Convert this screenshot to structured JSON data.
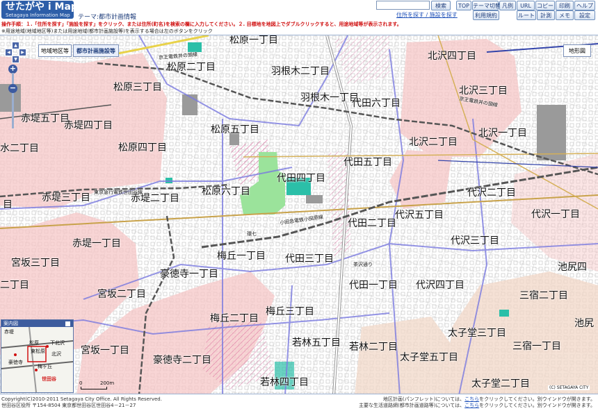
{
  "header": {
    "logo_title": "せたがや i Map",
    "logo_subtitle": "Setagaya Information Map",
    "theme_label": "テーマ:都市計画情報",
    "search_placeholder": "",
    "search_button": "検索",
    "buttons_row1": [
      "TOP",
      "テーマ切替",
      "凡例",
      "URL",
      "コピー",
      "印刷",
      "ヘルプ"
    ],
    "buttons_row2": [
      "利用規約",
      "ルート",
      "計測",
      "メモ",
      "設定"
    ],
    "address_search_link": "住所を探す",
    "link_separator": " / ",
    "facility_search_link": "施設を探す"
  },
  "instruction": "操作手順：１.「住所を探す」「施設を探す」をクリック、または住所(町名)を検索の欄に入力してください。２. 目標地を地図上でダブルクリックすると、用途地域等が表示されます。",
  "note": "※用途地域(地域地区等)または用途地域(都市計画施設等)を表示する場合は左のボタンをクリック",
  "map_tools": {
    "zoning_button": "地域地区等",
    "facility_button": "都市計画施設等",
    "map_type_button": "地形図",
    "zoom_in": "+",
    "zoom_out": "−"
  },
  "map_labels": [
    "松原一丁目",
    "松原二丁目",
    "羽根木二丁目",
    "北沢四丁目",
    "松原三丁目",
    "北沢三丁目",
    "羽根木一丁目",
    "代田六丁目",
    "赤堤五丁目",
    "赤堤四丁目",
    "松原五丁目",
    "北沢一丁目",
    "北沢二丁目",
    "水二丁目",
    "松原四丁目",
    "代田五丁目",
    "代田四丁目",
    "松原六丁目",
    "代沢二丁目",
    "目",
    "赤堤三丁目",
    "赤堤二丁目",
    "代沢五丁目",
    "代沢一丁目",
    "代田二丁目",
    "赤堤一丁目",
    "代沢三丁目",
    "梅丘一丁目",
    "代田三丁目",
    "宮坂三丁目",
    "池尻四",
    "豪徳寺一丁目",
    "代田一丁目",
    "代沢四丁目",
    "二丁目",
    "三宿二丁目",
    "宮坂二丁目",
    "梅丘三丁目",
    "梅丘二丁目",
    "池尻",
    "太子堂三丁目",
    "若林五丁目",
    "宮坂一丁目",
    "若林二丁目",
    "三宿一丁目",
    "太子堂五丁目",
    "豪徳寺二丁目",
    "若林四丁目",
    "太子堂二丁目"
  ],
  "map_small_labels": [
    "京王電鉄井の頭線",
    "東京急行電鉄世田谷線",
    "小田急電鉄小田原線",
    "京王電鉄井の頭線",
    "環七",
    "茶沢通り"
  ],
  "overview": {
    "title": "案内図",
    "labels": [
      "赤堤",
      "下北沢",
      "松原",
      "東松原",
      "豪徳寺",
      "梅ヶ丘",
      "世田谷",
      "北沢"
    ]
  },
  "scale_labels": [
    "0",
    "200m"
  ],
  "credit": "(C) SETAGAYA CITY",
  "footer": {
    "copyright": "Copyright(C)2010-2011 Setagaya City Office. All Rights Reserved.",
    "address": "世田谷区役所 〒154-8504 東京都世田谷区世田谷4－21－27",
    "plan_text_pre": "地区計画(パンフレット)については、",
    "plan_link": "こちら",
    "plan_text_post": "をクリックしてください。別ウインドウが開きます。",
    "road_text_pre": "主要な生活道路網(都市計画道路等)については、",
    "road_link": "こちら",
    "road_text_post": "をクリックしてください。別ウインドウが開きます。"
  },
  "colors": {
    "brand": "#2d5ea8",
    "residential_zone": "#f6c7c7",
    "commercial_zone": "#f2d8c8",
    "park": "#9be39b",
    "water_facility": "#2bbfa8",
    "district_line": "#7a7ae0",
    "railway": "#555555",
    "instruction_red": "#d01010"
  }
}
